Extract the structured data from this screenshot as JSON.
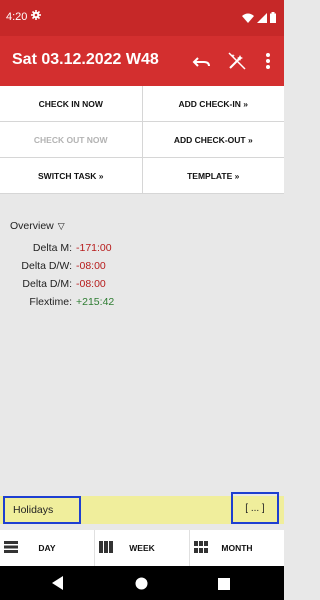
{
  "status_bar": {
    "time": "4:20",
    "icons": [
      "gear-icon",
      "wifi-icon",
      "signal-icon",
      "battery-icon"
    ]
  },
  "app_bar": {
    "title": "Sat 03.12.2022 W48",
    "actions": [
      "undo-icon",
      "auto-fix-icon",
      "more-vert-icon"
    ]
  },
  "actions": {
    "check_in_now": "CHECK IN NOW",
    "add_check_in": "ADD CHECK-IN »",
    "check_out_now": "CHECK OUT NOW",
    "add_check_out": "ADD CHECK-OUT »",
    "switch_task": "SWITCH TASK »",
    "template": "TEMPLATE »"
  },
  "overview": {
    "label": "Overview",
    "toggle_icon": "▽",
    "rows": [
      {
        "label": "Delta M:",
        "value": "-171:00",
        "status": "negative"
      },
      {
        "label": "Delta D/W:",
        "value": "-08:00",
        "status": "negative"
      },
      {
        "label": "Delta D/M:",
        "value": "-08:00",
        "status": "negative"
      },
      {
        "label": "Flextime:",
        "value": "+215:42",
        "status": "positive"
      }
    ]
  },
  "holiday_bar": {
    "label": "Holidays",
    "more": "[ ... ]"
  },
  "bottom_nav": {
    "day": "DAY",
    "week": "WEEK",
    "month": "MONTH"
  },
  "colors": {
    "status_bar": "#c62828",
    "app_bar": "#d32f2f",
    "negative": "#b71c1c",
    "positive": "#2e7d32",
    "holiday_bar": "#f0ee9c",
    "highlight_border": "#1e3fd1"
  }
}
